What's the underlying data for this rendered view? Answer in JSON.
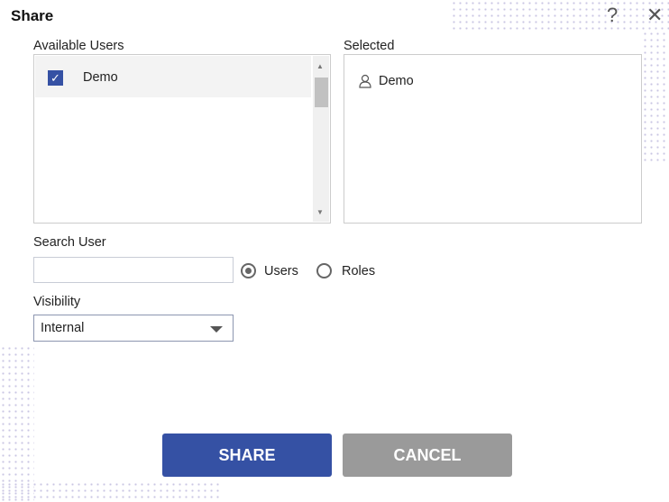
{
  "dialog": {
    "title": "Share",
    "help_icon": "question-icon",
    "close_icon": "close-icon"
  },
  "available": {
    "label": "Available Users",
    "items": [
      {
        "name": "Demo",
        "checked": true
      }
    ]
  },
  "selected": {
    "label": "Selected",
    "items": [
      {
        "name": "Demo",
        "icon": "user-icon"
      }
    ]
  },
  "search": {
    "label": "Search User",
    "value": "",
    "placeholder": "",
    "options": [
      {
        "label": "Users",
        "selected": true
      },
      {
        "label": "Roles",
        "selected": false
      }
    ]
  },
  "visibility": {
    "label": "Visibility",
    "value": "Internal"
  },
  "buttons": {
    "share": "SHARE",
    "cancel": "CANCEL"
  },
  "colors": {
    "primary": "#3551a4",
    "secondary": "#9a9a9a"
  }
}
